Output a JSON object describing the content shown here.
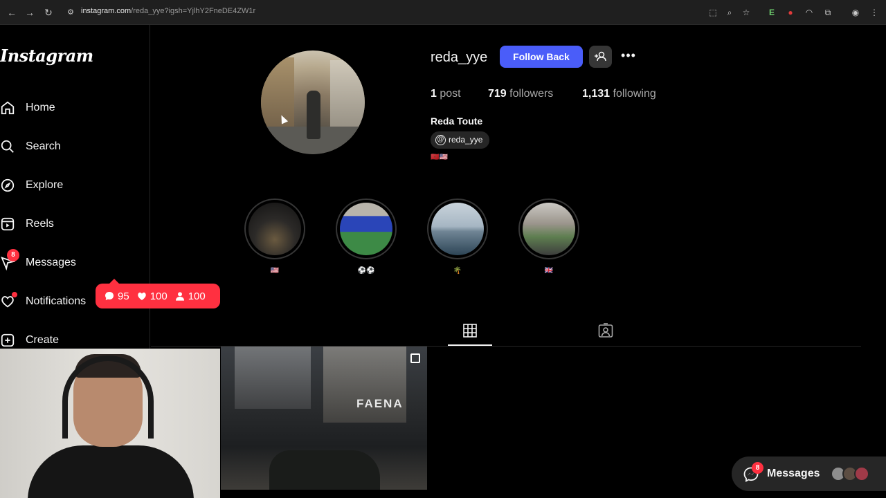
{
  "browser": {
    "url_host": "instagram.com",
    "url_path": "/reda_yye?igsh=YjlhY2FneDE4ZW1r"
  },
  "sidebar": {
    "logo": "Instagram",
    "items": [
      {
        "label": "Home",
        "icon": "home-icon"
      },
      {
        "label": "Search",
        "icon": "search-icon"
      },
      {
        "label": "Explore",
        "icon": "compass-icon"
      },
      {
        "label": "Reels",
        "icon": "reels-icon"
      },
      {
        "label": "Messages",
        "icon": "messenger-icon",
        "badge": "8"
      },
      {
        "label": "Notifications",
        "icon": "heart-icon"
      },
      {
        "label": "Create",
        "icon": "plus-square-icon"
      }
    ],
    "notification_pill": {
      "comments": "95",
      "likes": "100",
      "follows": "100"
    }
  },
  "profile": {
    "username": "reda_yye",
    "follow_button": "Follow Back",
    "posts_count": "1",
    "posts_label": "post",
    "followers_count": "719",
    "followers_label": "followers",
    "following_count": "1,131",
    "following_label": "following",
    "full_name": "Reda Toute",
    "threads_handle": "reda_yye",
    "bio_flags": "🇲🇦🇺🇸"
  },
  "highlights": [
    {
      "label": "🇺🇸"
    },
    {
      "label": "⚽⚽"
    },
    {
      "label": "🌴"
    },
    {
      "label": "🇬🇧"
    }
  ],
  "post": {
    "sign": "FAENA"
  },
  "messages_pill": {
    "label": "Messages",
    "badge": "8"
  },
  "colors": {
    "accent": "#4a5df9",
    "badge": "#ff3040",
    "background": "#000000"
  }
}
